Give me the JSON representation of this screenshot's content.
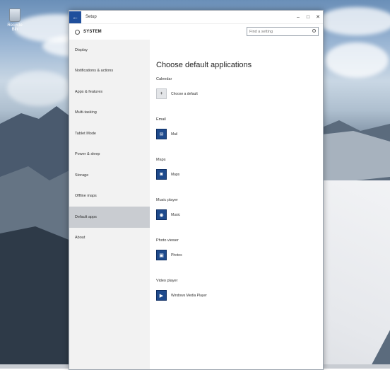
{
  "desktop": {
    "recycle_bin_label": "Recycle Bin"
  },
  "window": {
    "title": "Setup",
    "controls": {
      "minimize": "–",
      "maximize": "□",
      "close": "✕"
    },
    "back_glyph": "←",
    "section": "SYSTEM",
    "search_placeholder": "Find a setting"
  },
  "sidebar": {
    "items": [
      {
        "label": "Display"
      },
      {
        "label": "Notifications & actions"
      },
      {
        "label": "Apps & features"
      },
      {
        "label": "Multi-tasking"
      },
      {
        "label": "Tablet Mode"
      },
      {
        "label": "Power & sleep"
      },
      {
        "label": "Storage"
      },
      {
        "label": "Offline maps"
      },
      {
        "label": "Default apps"
      },
      {
        "label": "About"
      }
    ],
    "active_index": 8
  },
  "content": {
    "title": "Choose default applications",
    "groups": [
      {
        "label": "Calendar",
        "app": "Choose a default",
        "icon": "plus-icon",
        "glyph": "+"
      },
      {
        "label": "Email",
        "app": "Mail",
        "icon": "mail-icon",
        "glyph": "✉"
      },
      {
        "label": "Maps",
        "app": "Maps",
        "icon": "maps-icon",
        "glyph": "◙"
      },
      {
        "label": "Music player",
        "app": "Music",
        "icon": "music-icon",
        "glyph": "◉"
      },
      {
        "label": "Photo viewer",
        "app": "Photos",
        "icon": "photos-icon",
        "glyph": "▣"
      },
      {
        "label": "Video player",
        "app": "Windows Media Player",
        "icon": "video-icon",
        "glyph": "▶"
      }
    ]
  },
  "colors": {
    "accent": "#1e4a8c",
    "sidebar_bg": "#f2f2f2",
    "sidebar_active": "#c9ccd1"
  }
}
